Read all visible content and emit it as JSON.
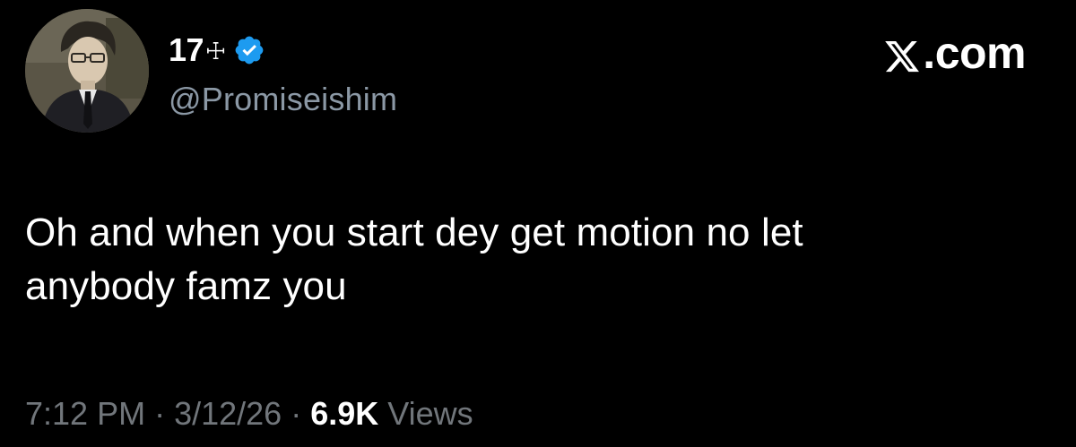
{
  "author": {
    "display_name": "17",
    "name_glyph": "☩",
    "handle": "@Promiseishim",
    "verified": true,
    "avatar": "avatar-image"
  },
  "brand": {
    "label": ".com",
    "icon": "x-logo-icon"
  },
  "tweet": {
    "text_line1": "Oh and when you start dey get motion no let",
    "text_line2": "anybody famz you"
  },
  "meta": {
    "time": "7:12 PM",
    "separator": " · ",
    "date": "3/12/26",
    "views_count": "6.9K",
    "views_label": "Views"
  },
  "colors": {
    "background": "#000000",
    "text_primary": "#ffffff",
    "text_secondary": "#71767b",
    "handle": "#8b98a5",
    "verified_badge": "#1d9bf0"
  }
}
